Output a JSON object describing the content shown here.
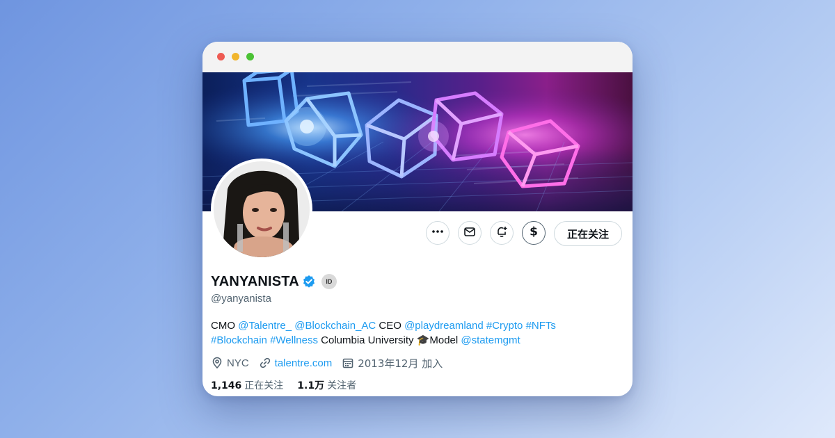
{
  "window": {
    "controls": [
      "close",
      "minimize",
      "zoom"
    ]
  },
  "profile": {
    "display_name": "YANYANISTA",
    "verified_icon": "verified-badge-icon",
    "id_badge": "ID",
    "handle": "@yanyanista",
    "bio_parts": [
      {
        "text": "CMO ",
        "type": "text"
      },
      {
        "text": "@Talentre_",
        "type": "link"
      },
      {
        "text": " ",
        "type": "text"
      },
      {
        "text": "@Blockchain_AC",
        "type": "link"
      },
      {
        "text": " CEO ",
        "type": "text"
      },
      {
        "text": "@playdreamland",
        "type": "link"
      },
      {
        "text": " ",
        "type": "text"
      },
      {
        "text": "#Crypto",
        "type": "link"
      },
      {
        "text": " ",
        "type": "text"
      },
      {
        "text": "#NFTs",
        "type": "link"
      },
      {
        "text": "#Blockchain",
        "type": "link"
      },
      {
        "text": " ",
        "type": "text"
      },
      {
        "text": "#Wellness",
        "type": "link"
      },
      {
        "text": " Columbia University 🎓Model ",
        "type": "text"
      },
      {
        "text": "@statemgmt",
        "type": "link"
      }
    ],
    "location": "NYC",
    "website": "talentre.com",
    "joined": "2013年12月 加入",
    "following_count": "1,146",
    "following_label": "正在关注",
    "followers_count": "1.1万",
    "followers_label": "关注者"
  },
  "actions": {
    "more_icon": "more-dots-icon",
    "message_icon": "mail-icon",
    "notify_icon": "bell-plus-icon",
    "tip_icon": "dollar-tip-icon",
    "follow_label": "正在关注"
  },
  "colors": {
    "accent": "#1d9bf0",
    "text_primary": "#0f1419",
    "text_secondary": "#536471",
    "border": "#cfd9de"
  }
}
